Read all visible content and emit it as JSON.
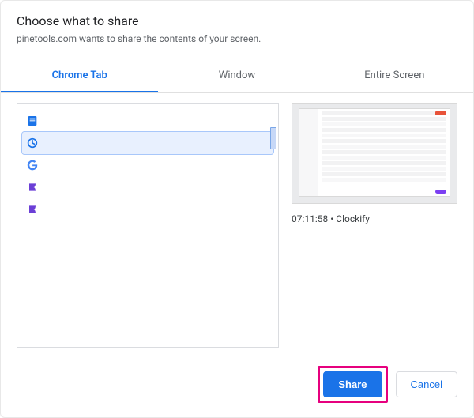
{
  "header": {
    "title": "Choose what to share",
    "subtitle": "pinetools.com wants to share the contents of your screen."
  },
  "tabs": {
    "chrome_tab": "Chrome Tab",
    "window": "Window",
    "entire_screen": "Entire Screen"
  },
  "tab_items": [
    {
      "icon": "document-icon"
    },
    {
      "icon": "clockify-icon"
    },
    {
      "icon": "google-icon"
    },
    {
      "icon": "app-icon"
    },
    {
      "icon": "app-icon"
    }
  ],
  "preview": {
    "caption": "07:11:58 • Clockify"
  },
  "footer": {
    "share": "Share",
    "cancel": "Cancel"
  },
  "colors": {
    "accent": "#1a73e8",
    "highlight": "#e6007e"
  }
}
